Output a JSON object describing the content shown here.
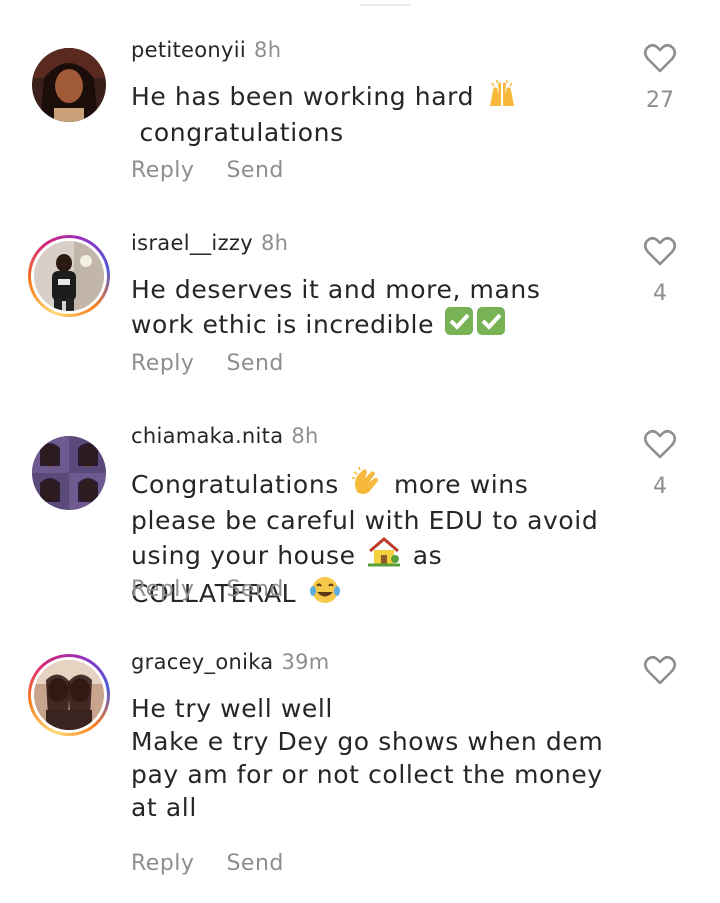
{
  "comments": [
    {
      "username": "petiteonyii",
      "time": "8h",
      "text_parts": [
        "He has been working hard ",
        " congratulations"
      ],
      "emojis": [
        "raised-hands"
      ],
      "likes": "27",
      "reply_label": "Reply",
      "send_label": "Send",
      "story_ring": false
    },
    {
      "username": "israel__izzy",
      "time": "8h",
      "text_parts": [
        "He deserves it and more, mans work ethic is incredible "
      ],
      "emojis": [
        "check-mark",
        "check-mark"
      ],
      "likes": "4",
      "reply_label": "Reply",
      "send_label": "Send",
      "story_ring": true
    },
    {
      "username": "chiamaka.nita",
      "time": "8h",
      "text_parts": [
        "Congratulations ",
        " more wins please be careful with EDU to avoid using your house ",
        " as COLLATERAL "
      ],
      "emojis": [
        "clapping-hands",
        "house",
        "tears-of-joy"
      ],
      "likes": "4",
      "reply_label": "Reply",
      "send_label": "Send",
      "story_ring": false
    },
    {
      "username": "gracey_onika",
      "time": "39m",
      "text": "He try well well\nMake e try Dey go shows when dem pay am for or not collect the money at all",
      "likes": "",
      "reply_label": "Reply",
      "send_label": "Send",
      "story_ring": true
    }
  ],
  "colors": {
    "text": "#262626",
    "muted": "#8e8e8e",
    "background": "#ffffff"
  }
}
